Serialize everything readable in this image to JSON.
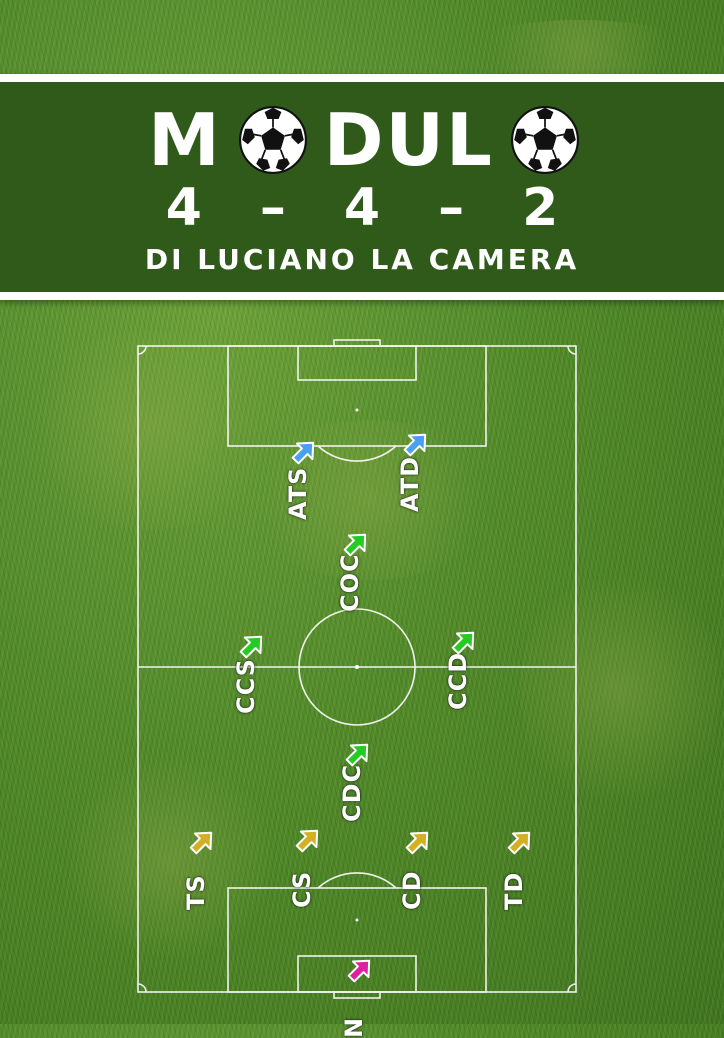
{
  "title": {
    "letters_before": "M",
    "letters_after": "DUL",
    "formation": [
      "4",
      "–",
      "4",
      "–",
      "2"
    ],
    "byline": "DI LUCIANO LA CAMERA"
  },
  "colors": {
    "banner": "#2f5a1a",
    "attack": "#4aa0f0",
    "midfield": "#22cc22",
    "defense": "#d4b020",
    "goalkeeper": "#e020a0"
  },
  "players": [
    {
      "role": "ATS",
      "line": "attack"
    },
    {
      "role": "ATD",
      "line": "attack"
    },
    {
      "role": "COC",
      "line": "midfield"
    },
    {
      "role": "CCS",
      "line": "midfield"
    },
    {
      "role": "CCD",
      "line": "midfield"
    },
    {
      "role": "CDC",
      "line": "midfield"
    },
    {
      "role": "TS",
      "line": "defense"
    },
    {
      "role": "CS",
      "line": "defense"
    },
    {
      "role": "CD",
      "line": "defense"
    },
    {
      "role": "TD",
      "line": "defense"
    },
    {
      "role": "N",
      "line": "goalkeeper"
    }
  ]
}
